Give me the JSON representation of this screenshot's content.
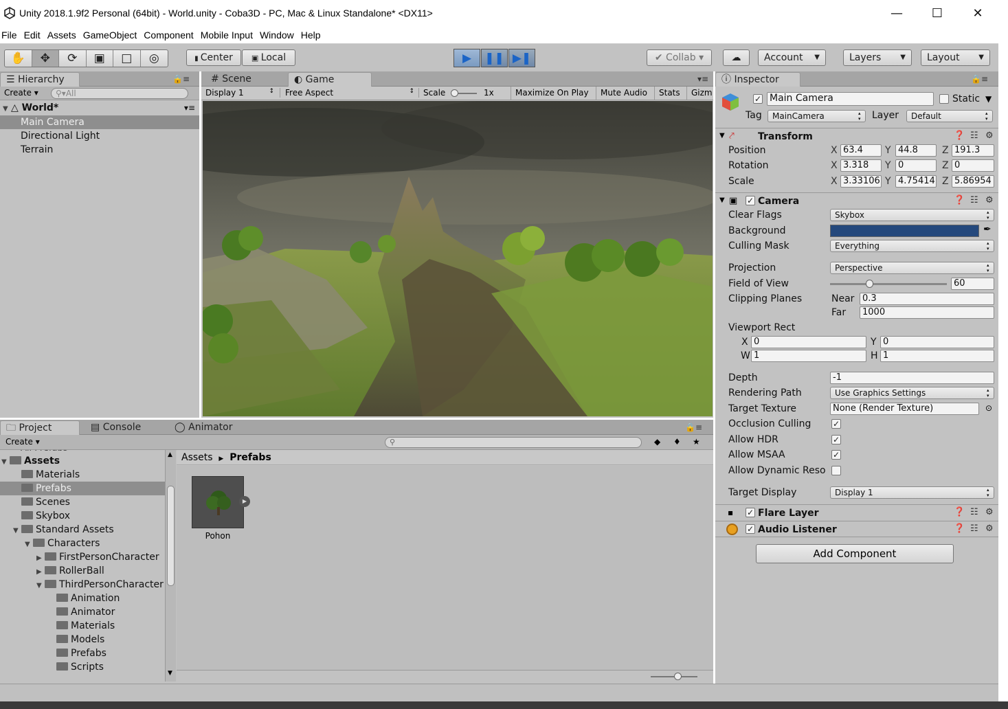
{
  "window": {
    "title": "Unity 2018.1.9f2 Personal (64bit) - World.unity - Coba3D - PC, Mac & Linux Standalone* <DX11>",
    "minimize": "—",
    "maximize": "☐",
    "close": "✕"
  },
  "menu": [
    "File",
    "Edit",
    "Assets",
    "GameObject",
    "Component",
    "Mobile Input",
    "Window",
    "Help"
  ],
  "toolbar": {
    "pivot": "Center",
    "space": "Local",
    "collab": "Collab",
    "account": "Account",
    "layers": "Layers",
    "layout": "Layout"
  },
  "hierarchy": {
    "tab": "Hierarchy",
    "create": "Create",
    "search_placeholder": "All",
    "scene": "World*",
    "items": [
      "Main Camera",
      "Directional Light",
      "Terrain"
    ]
  },
  "game": {
    "tab_scene": "Scene",
    "tab_game": "Game",
    "display": "Display 1",
    "aspect": "Free Aspect",
    "scale_label": "Scale",
    "scale_value": "1x",
    "maximize": "Maximize On Play",
    "mute": "Mute Audio",
    "stats": "Stats",
    "gizmos": "Gizm"
  },
  "project": {
    "tab_project": "Project",
    "tab_console": "Console",
    "tab_animator": "Animator",
    "create": "Create",
    "partial_top": "All Prefabs",
    "tree": [
      {
        "label": "Assets",
        "indent": 0,
        "arrow": "▼",
        "bold": true
      },
      {
        "label": "Materials",
        "indent": 1,
        "arrow": ""
      },
      {
        "label": "Prefabs",
        "indent": 1,
        "arrow": "",
        "selected": true
      },
      {
        "label": "Scenes",
        "indent": 1,
        "arrow": ""
      },
      {
        "label": "Skybox",
        "indent": 1,
        "arrow": ""
      },
      {
        "label": "Standard Assets",
        "indent": 1,
        "arrow": "▼"
      },
      {
        "label": "Characters",
        "indent": 2,
        "arrow": "▼"
      },
      {
        "label": "FirstPersonCharacter",
        "indent": 3,
        "arrow": "▶"
      },
      {
        "label": "RollerBall",
        "indent": 3,
        "arrow": "▶"
      },
      {
        "label": "ThirdPersonCharacter",
        "indent": 3,
        "arrow": "▼"
      },
      {
        "label": "Animation",
        "indent": 4,
        "arrow": ""
      },
      {
        "label": "Animator",
        "indent": 4,
        "arrow": ""
      },
      {
        "label": "Materials",
        "indent": 4,
        "arrow": ""
      },
      {
        "label": "Models",
        "indent": 4,
        "arrow": ""
      },
      {
        "label": "Prefabs",
        "indent": 4,
        "arrow": ""
      },
      {
        "label": "Scripts",
        "indent": 4,
        "arrow": ""
      }
    ],
    "breadcrumb_root": "Assets",
    "breadcrumb_current": "Prefabs",
    "asset_name": "Pohon"
  },
  "inspector": {
    "tab": "Inspector",
    "object_name": "Main Camera",
    "static": "Static",
    "tag_label": "Tag",
    "tag": "MainCamera",
    "layer_label": "Layer",
    "layer": "Default",
    "transform": {
      "title": "Transform",
      "position_label": "Position",
      "rotation_label": "Rotation",
      "scale_label": "Scale",
      "position": {
        "x": "63.4",
        "y": "44.8",
        "z": "191.3"
      },
      "rotation": {
        "x": "3.318",
        "y": "0",
        "z": "0"
      },
      "scale": {
        "x": "3.33106",
        "y": "4.75414",
        "z": "5.86954"
      }
    },
    "camera": {
      "title": "Camera",
      "clear_flags_label": "Clear Flags",
      "clear_flags": "Skybox",
      "background_label": "Background",
      "background_color": "#24487c",
      "culling_mask_label": "Culling Mask",
      "culling_mask": "Everything",
      "projection_label": "Projection",
      "projection": "Perspective",
      "fov_label": "Field of View",
      "fov": "60",
      "clipping_label": "Clipping Planes",
      "near_label": "Near",
      "near": "0.3",
      "far_label": "Far",
      "far": "1000",
      "viewport_label": "Viewport Rect",
      "vx": "0",
      "vy": "0",
      "vw": "1",
      "vh": "1",
      "depth_label": "Depth",
      "depth": "-1",
      "rendering_path_label": "Rendering Path",
      "rendering_path": "Use Graphics Settings",
      "target_texture_label": "Target Texture",
      "target_texture": "None (Render Texture)",
      "occlusion_label": "Occlusion Culling",
      "hdr_label": "Allow HDR",
      "msaa_label": "Allow MSAA",
      "dynres_label": "Allow Dynamic Reso",
      "target_display_label": "Target Display",
      "target_display": "Display 1"
    },
    "flare_layer": "Flare Layer",
    "audio_listener": "Audio Listener",
    "add_component": "Add Component"
  }
}
